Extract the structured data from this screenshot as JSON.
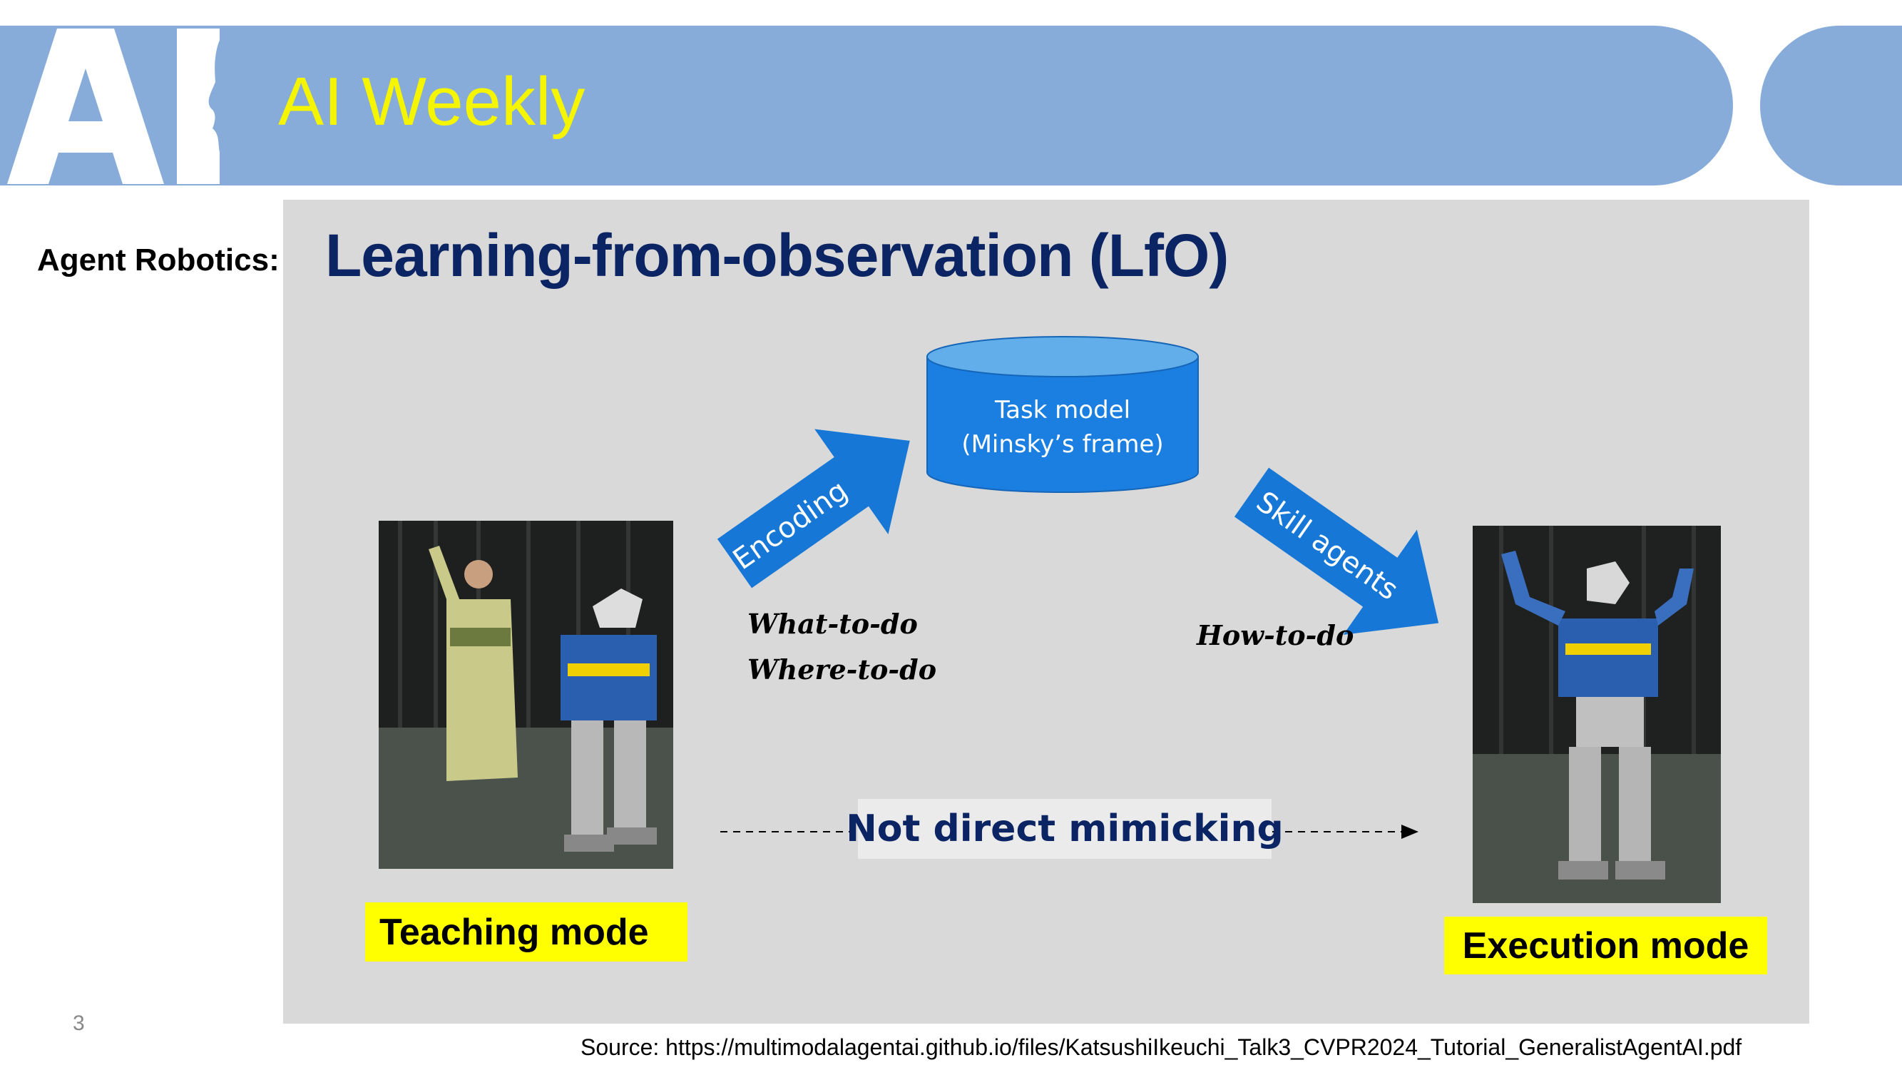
{
  "header": {
    "logo_text": "AI",
    "title": "AI Weekly"
  },
  "slide": {
    "section_label": "Agent Robotics:",
    "title": "Learning-from-observation (LfO)",
    "task_model": {
      "line1": "Task model",
      "line2": "(Minsky’s frame)"
    },
    "encoding_label": "Encoding",
    "skill_agents_label": "Skill agents",
    "what_to_do": "What-to-do",
    "where_to_do": "Where-to-do",
    "how_to_do": "How-to-do",
    "mimic_label": "Not direct mimicking",
    "teaching_label": "Teaching mode",
    "execution_label": "Execution mode"
  },
  "footer": {
    "page_number": "3",
    "source": "Source: https://multimodalagentai.github.io/files/KatsushiIkeuchi_Talk3_CVPR2024_Tutorial_GeneralistAgentAI.pdf"
  },
  "colors": {
    "header_band": "#88acd9",
    "header_title": "#f5f500",
    "slide_bg": "#d9d9d9",
    "title_navy": "#0b2463",
    "arrow_blue": "#1677d6",
    "cylinder_blue": "#1a7fe0",
    "highlight_yellow": "#ffff00"
  }
}
